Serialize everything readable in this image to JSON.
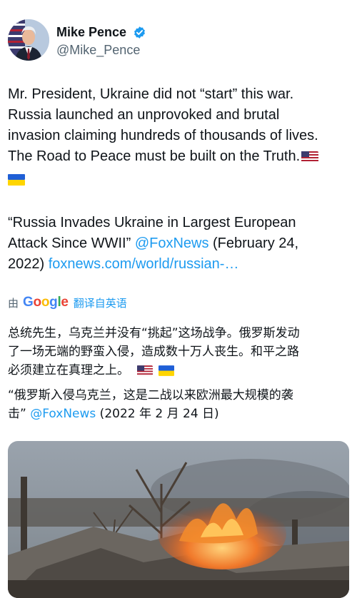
{
  "author": {
    "display_name": "Mike Pence",
    "handle": "@Mike_Pence"
  },
  "icons": {
    "verified": "verified-badge-icon",
    "flag_us": "us-flag-icon",
    "flag_ua": "ukraine-flag-icon"
  },
  "tweet": {
    "line1": "Mr. President, Ukraine did not “start” this war.",
    "line2": "Russia launched an unprovoked and brutal",
    "line3": "invasion claiming hundreds of thousands of lives.",
    "line4": "The Road to Peace must be built on the Truth.",
    "quote1": "“Russia Invades Ukraine in Largest European",
    "quote2_pre": "Attack Since WWII” ",
    "mention": "@FoxNews",
    "quote2_post": " (February 24,",
    "quote3_pre": "2022) ",
    "url": "foxnews.com/world/russian-…"
  },
  "translation": {
    "by": "由",
    "provider": "Google",
    "label": "翻译自英语",
    "zh_line1": "总统先生，乌克兰并没有“挑起”这场战争。俄罗斯发动",
    "zh_line2": "了一场无端的野蛮入侵，造成数十万人丧生。和平之路",
    "zh_line3": "必须建立在真理之上。",
    "zh_quote1": "“俄罗斯入侵乌克兰，这是二战以来欧洲最大规模的袭",
    "zh_quote2_pre": "击” ",
    "zh_mention": "@FoxNews",
    "zh_quote2_post": " (2022 年 2 月 24 日)"
  },
  "colors": {
    "link": "#1d9bf0",
    "verified": "#1d9bf0",
    "secondary_text": "#536471",
    "google_blue": "#4285f4",
    "google_red": "#ea4335",
    "google_yellow": "#fbbc05",
    "google_green": "#34a853"
  }
}
